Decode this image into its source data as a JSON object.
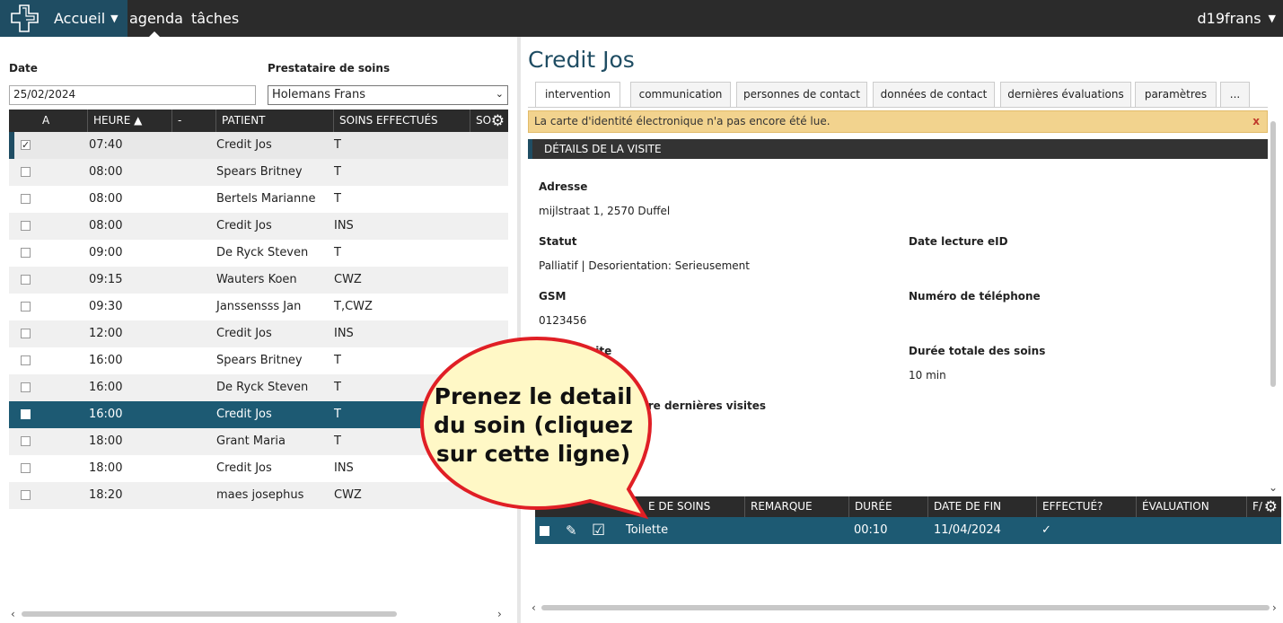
{
  "topbar": {
    "home_label": "Accueil",
    "agenda_label": "agenda",
    "tasks_label": "tâches",
    "user_label": "d19frans"
  },
  "filters": {
    "date_label": "Date",
    "date_value": "25/02/2024",
    "provider_label": "Prestataire de soins",
    "provider_value": "Holemans Frans"
  },
  "agenda": {
    "columns": [
      "A",
      "HEURE ▲",
      "-",
      "PATIENT",
      "SOINS EFFECTUÉS",
      "SO"
    ],
    "rows": [
      {
        "checked": "✓",
        "time": "07:40",
        "patient": "Credit Jos",
        "care": "T"
      },
      {
        "checked": "",
        "time": "08:00",
        "patient": "Spears Britney",
        "care": "T"
      },
      {
        "checked": "",
        "time": "08:00",
        "patient": "Bertels Marianne",
        "care": "T"
      },
      {
        "checked": "",
        "time": "08:00",
        "patient": "Credit Jos",
        "care": "INS"
      },
      {
        "checked": "",
        "time": "09:00",
        "patient": "De Ryck Steven",
        "care": "T"
      },
      {
        "checked": "",
        "time": "09:15",
        "patient": "Wauters Koen",
        "care": "CWZ"
      },
      {
        "checked": "",
        "time": "09:30",
        "patient": "Janssensss Jan",
        "care": "T,CWZ"
      },
      {
        "checked": "",
        "time": "12:00",
        "patient": "Credit Jos",
        "care": "INS"
      },
      {
        "checked": "",
        "time": "16:00",
        "patient": "Spears Britney",
        "care": "T"
      },
      {
        "checked": "",
        "time": "16:00",
        "patient": "De Ryck Steven",
        "care": "T"
      },
      {
        "checked": "",
        "time": "16:00",
        "patient": "Credit Jos",
        "care": "T"
      },
      {
        "checked": "",
        "time": "18:00",
        "patient": "Grant Maria",
        "care": "T"
      },
      {
        "checked": "",
        "time": "18:00",
        "patient": "Credit Jos",
        "care": "INS"
      },
      {
        "checked": "",
        "time": "18:20",
        "patient": "maes josephus",
        "care": "CWZ"
      }
    ]
  },
  "patient": {
    "title": "Credit Jos",
    "tabs": [
      "intervention",
      "communication",
      "personnes de contact",
      "données de contact",
      "dernières évaluations",
      "paramètres",
      "..."
    ],
    "alert_text": "La carte d'identité électronique n'a pas encore été lue.",
    "alert_close": "x",
    "section_title": "DÉTAILS DE LA VISITE",
    "fields": {
      "address_label": "Adresse",
      "address_value": "mijlstraat 1, 2570 Duffel",
      "status_label": "Statut",
      "status_value": "Palliatif | Desorientation: Serieusement",
      "eid_label": "Date lecture eID",
      "gsm_label": "GSM",
      "gsm_value": "0123456",
      "phone_label": "Numéro de téléphone",
      "visit_label": "isite",
      "duration_label": "Durée totale des soins",
      "duration_value": "10 min",
      "last_visits_label": "tre dernières visites"
    }
  },
  "care_table": {
    "columns": [
      "E DE SOINS",
      "REMARQUE",
      "DURÉE",
      "DATE DE FIN",
      "EFFECTUÉ?",
      "ÉVALUATION",
      "F/"
    ],
    "row": {
      "name": "Toilette",
      "duration": "00:10",
      "end_date": "11/04/2024",
      "done": "✓"
    }
  },
  "callout": {
    "text": "Prenez le detail du soin (cliquez sur cette ligne)"
  }
}
